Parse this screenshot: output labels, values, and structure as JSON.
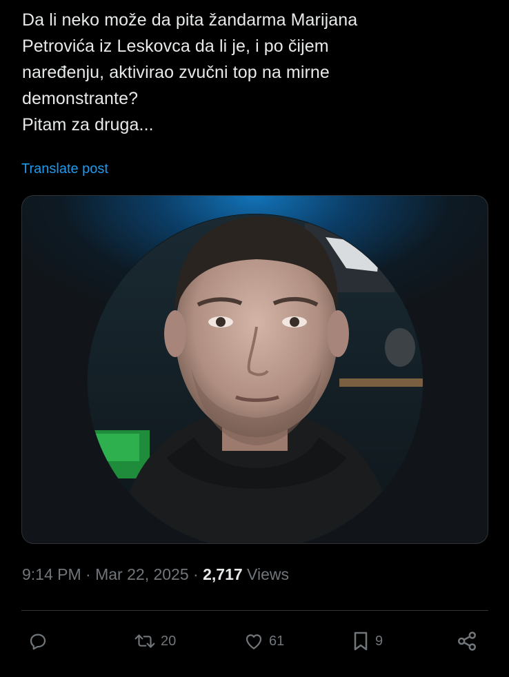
{
  "post": {
    "text_lines": [
      "Da li neko može da pita žandarma Marijana",
      "Petrovića iz Leskovca da li je, i po čijem",
      "naređenju, aktivirao zvučni top na mirne",
      "demonstrante?",
      "Pitam za druga..."
    ],
    "translate_label": "Translate post"
  },
  "meta": {
    "time": "9:14 PM",
    "separator": "·",
    "date": "Mar 22, 2025",
    "views_count": "2,717",
    "views_label": "Views"
  },
  "actions": {
    "reply_icon": "reply-icon",
    "repost_icon": "repost-icon",
    "repost_count": "20",
    "like_icon": "heart-icon",
    "like_count": "61",
    "bookmark_icon": "bookmark-icon",
    "bookmark_count": "9",
    "share_icon": "share-icon"
  },
  "colors": {
    "background": "#000000",
    "text": "#e7e9ea",
    "muted": "#71767b",
    "link": "#1d9bf0",
    "border": "#2f3336"
  }
}
